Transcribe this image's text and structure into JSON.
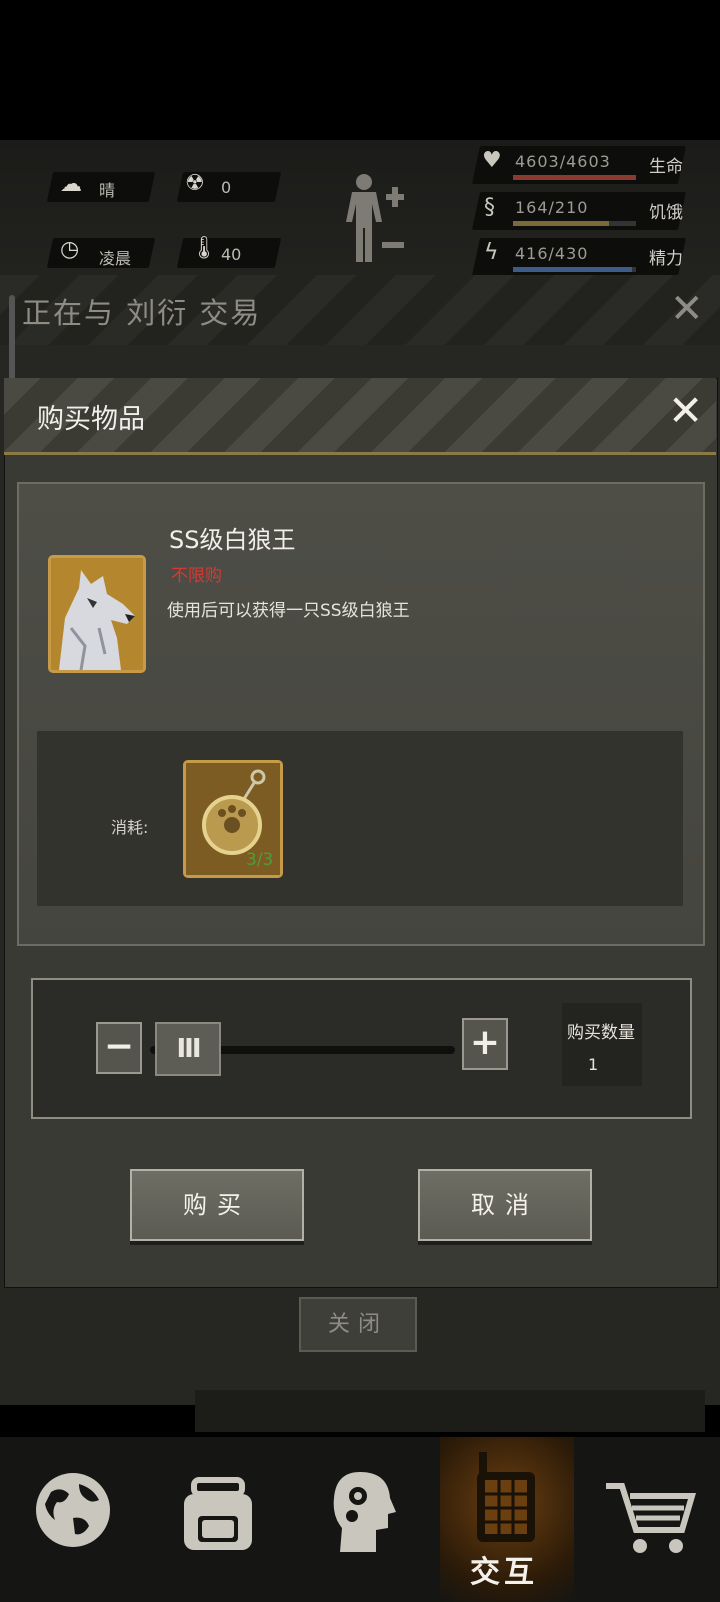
{
  "status": {
    "weather": "晴",
    "radiation": "0",
    "time_of_day": "凌晨",
    "temperature": "40",
    "health": {
      "value": "4603/4603",
      "label": "生命",
      "fraction": 1.0,
      "color": "#8b3a30"
    },
    "hunger": {
      "value": "164/210",
      "label": "饥饿",
      "fraction": 0.78,
      "color": "#7a6a3a"
    },
    "energy": {
      "value": "416/430",
      "label": "精力",
      "fraction": 0.97,
      "color": "#3d5c8a"
    }
  },
  "trade": {
    "title": "正在与 刘衍 交易"
  },
  "modal": {
    "title": "购买物品",
    "item": {
      "name": "SS级白狼王",
      "limit": "不限购",
      "description": "使用后可以获得一只SS级白狼王"
    },
    "cost": {
      "label": "消耗:",
      "count": "3/3"
    },
    "quantity": {
      "label": "购买数量",
      "value": "1",
      "minus": "−",
      "plus": "+",
      "thumb": "III"
    },
    "buy_label": "购买",
    "cancel_label": "取消"
  },
  "close_label": "关闭",
  "nav": {
    "active_label": "交互"
  },
  "icons": [
    "cloud-sun-icon",
    "radiation-icon",
    "clock-icon",
    "thermometer-icon",
    "body-icon",
    "heart-icon",
    "stomach-icon",
    "brain-bolt-icon",
    "globe-icon",
    "backpack-icon",
    "head-gear-icon",
    "walkie-talkie-icon",
    "cart-icon",
    "close-icon"
  ]
}
